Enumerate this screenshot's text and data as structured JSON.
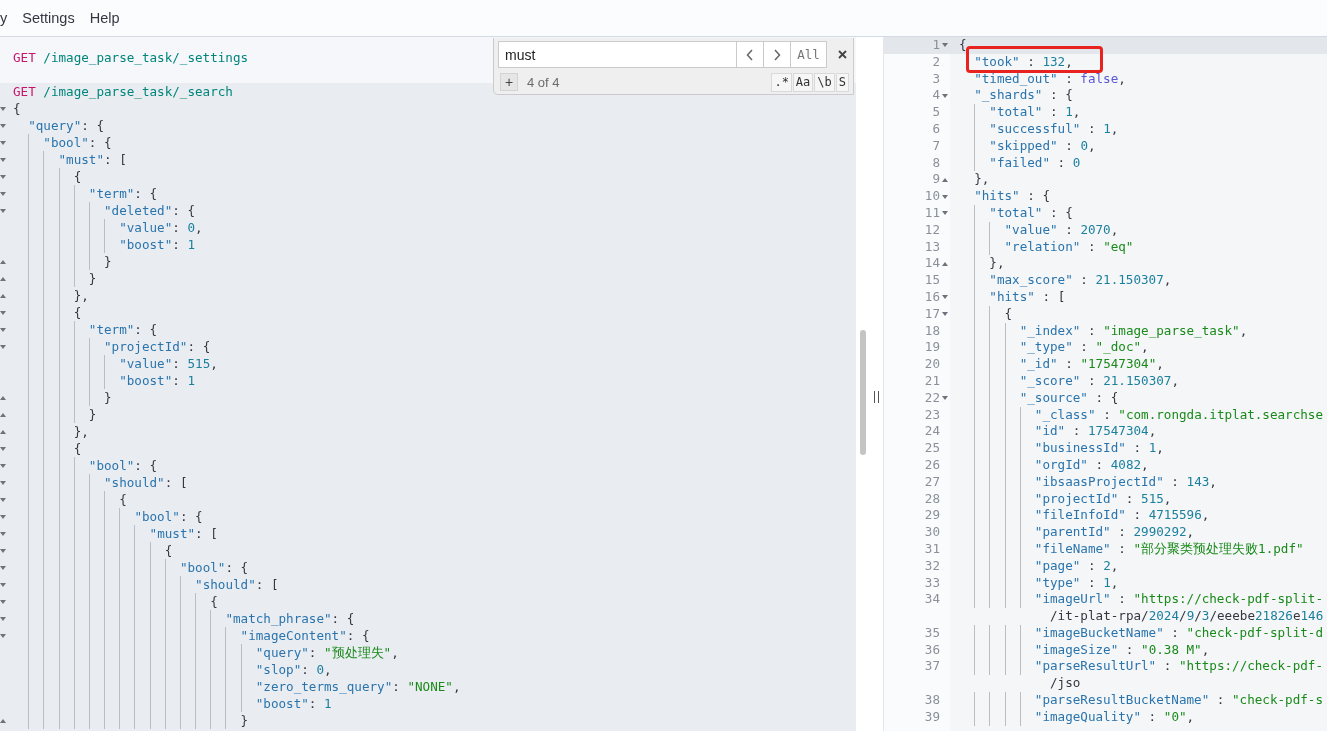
{
  "menu": [
    "y",
    "Settings",
    "Help"
  ],
  "console": {
    "requests": [
      {
        "method": "GET",
        "path": "/image_parse_task/_settings",
        "selected": false
      },
      {
        "method": "GET",
        "path": "/image_parse_task/_search",
        "selected": true,
        "lines": [
          {
            "text": "{",
            "kind": "open"
          },
          {
            "text": "  \"query\": {",
            "kind": "open"
          },
          {
            "text": "    \"bool\": {",
            "kind": "open"
          },
          {
            "text": "      \"must\": [",
            "kind": "open"
          },
          {
            "text": "        {",
            "kind": "open"
          },
          {
            "text": "          \"term\": {",
            "kind": "open"
          },
          {
            "text": "            \"deleted\": {",
            "kind": "open"
          },
          {
            "text": "              \"value\": 0,",
            "kind": "plain"
          },
          {
            "text": "              \"boost\": 1",
            "kind": "plain"
          },
          {
            "text": "            }",
            "kind": "close"
          },
          {
            "text": "          }",
            "kind": "close"
          },
          {
            "text": "        },",
            "kind": "close"
          },
          {
            "text": "        {",
            "kind": "open"
          },
          {
            "text": "          \"term\": {",
            "kind": "open"
          },
          {
            "text": "            \"projectId\": {",
            "kind": "open"
          },
          {
            "text": "              \"value\": 515,",
            "kind": "plain"
          },
          {
            "text": "              \"boost\": 1",
            "kind": "plain"
          },
          {
            "text": "            }",
            "kind": "close"
          },
          {
            "text": "          }",
            "kind": "close"
          },
          {
            "text": "        },",
            "kind": "close"
          },
          {
            "text": "        {",
            "kind": "open"
          },
          {
            "text": "          \"bool\": {",
            "kind": "open"
          },
          {
            "text": "            \"should\": [",
            "kind": "open"
          },
          {
            "text": "              {",
            "kind": "open"
          },
          {
            "text": "                \"bool\": {",
            "kind": "open"
          },
          {
            "text": "                  \"must\": [",
            "kind": "open"
          },
          {
            "text": "                    {",
            "kind": "open"
          },
          {
            "text": "                      \"bool\": {",
            "kind": "open"
          },
          {
            "text": "                        \"should\": [",
            "kind": "open"
          },
          {
            "text": "                          {",
            "kind": "open"
          },
          {
            "text": "                            \"match_phrase\": {",
            "kind": "open"
          },
          {
            "text": "                              \"imageContent\": {",
            "kind": "open"
          },
          {
            "text": "                                \"query\": \"预处理失\",",
            "kind": "plain"
          },
          {
            "text": "                                \"slop\": 0,",
            "kind": "plain"
          },
          {
            "text": "                                \"zero_terms_query\": \"NONE\",",
            "kind": "plain"
          },
          {
            "text": "                                \"boost\": 1",
            "kind": "plain"
          },
          {
            "text": "                              }",
            "kind": "close"
          }
        ]
      }
    ]
  },
  "search": {
    "value": "must",
    "all_label": "All",
    "replace_toggle": "+",
    "result": "4 of 4",
    "options": [
      ".*",
      "Aa",
      "\\b",
      "S"
    ]
  },
  "response": {
    "annotation": {
      "color": "#e8231f"
    },
    "lines": [
      {
        "n": "1",
        "text": "{",
        "kind": "open",
        "current": true
      },
      {
        "n": "2",
        "text": "  \"took\" : 132,",
        "kind": "plain",
        "current": false
      },
      {
        "n": "3",
        "text": "  \"timed_out\" : false,",
        "kind": "plain",
        "current": false
      },
      {
        "n": "4",
        "text": "  \"_shards\" : {",
        "kind": "open",
        "current": false
      },
      {
        "n": "5",
        "text": "    \"total\" : 1,",
        "kind": "plain",
        "current": false
      },
      {
        "n": "6",
        "text": "    \"successful\" : 1,",
        "kind": "plain",
        "current": false
      },
      {
        "n": "7",
        "text": "    \"skipped\" : 0,",
        "kind": "plain",
        "current": false
      },
      {
        "n": "8",
        "text": "    \"failed\" : 0",
        "kind": "plain",
        "current": false
      },
      {
        "n": "9",
        "text": "  },",
        "kind": "close",
        "current": false
      },
      {
        "n": "10",
        "text": "  \"hits\" : {",
        "kind": "open",
        "current": false
      },
      {
        "n": "11",
        "text": "    \"total\" : {",
        "kind": "open",
        "current": false
      },
      {
        "n": "12",
        "text": "      \"value\" : 2070,",
        "kind": "plain",
        "current": false
      },
      {
        "n": "13",
        "text": "      \"relation\" : \"eq\"",
        "kind": "plain",
        "current": false
      },
      {
        "n": "14",
        "text": "    },",
        "kind": "close",
        "current": false
      },
      {
        "n": "15",
        "text": "    \"max_score\" : 21.150307,",
        "kind": "plain",
        "current": false
      },
      {
        "n": "16",
        "text": "    \"hits\" : [",
        "kind": "open",
        "current": false
      },
      {
        "n": "17",
        "text": "      {",
        "kind": "open",
        "current": false
      },
      {
        "n": "18",
        "text": "        \"_index\" : \"image_parse_task\",",
        "kind": "plain",
        "current": false
      },
      {
        "n": "19",
        "text": "        \"_type\" : \"_doc\",",
        "kind": "plain",
        "current": false
      },
      {
        "n": "20",
        "text": "        \"_id\" : \"17547304\",",
        "kind": "plain",
        "current": false
      },
      {
        "n": "21",
        "text": "        \"_score\" : 21.150307,",
        "kind": "plain",
        "current": false
      },
      {
        "n": "22",
        "text": "        \"_source\" : {",
        "kind": "open",
        "current": false
      },
      {
        "n": "23",
        "text": "          \"_class\" : \"com.rongda.itplat.searchse",
        "kind": "plain",
        "current": false
      },
      {
        "n": "24",
        "text": "          \"id\" : 17547304,",
        "kind": "plain",
        "current": false
      },
      {
        "n": "25",
        "text": "          \"businessId\" : 1,",
        "kind": "plain",
        "current": false
      },
      {
        "n": "26",
        "text": "          \"orgId\" : 4082,",
        "kind": "plain",
        "current": false
      },
      {
        "n": "27",
        "text": "          \"ibsaasProjectId\" : 143,",
        "kind": "plain",
        "current": false
      },
      {
        "n": "28",
        "text": "          \"projectId\" : 515,",
        "kind": "plain",
        "current": false
      },
      {
        "n": "29",
        "text": "          \"fileInfoId\" : 4715596,",
        "kind": "plain",
        "current": false
      },
      {
        "n": "30",
        "text": "          \"parentId\" : 2990292,",
        "kind": "plain",
        "current": false
      },
      {
        "n": "31",
        "text": "          \"fileName\" : \"部分聚类预处理失败1.pdf\"",
        "kind": "plain",
        "current": false
      },
      {
        "n": "32",
        "text": "          \"page\" : 2,",
        "kind": "plain",
        "current": false
      },
      {
        "n": "33",
        "text": "          \"type\" : 1,",
        "kind": "plain",
        "current": false
      },
      {
        "n": "34",
        "text": "          \"imageUrl\" : \"https://check-pdf-split-",
        "wrap": "/it-plat-rpa/2024/9/3/eeebe21826e146",
        "kind": "plain",
        "current": false
      },
      {
        "n": "35",
        "text": "          \"imageBucketName\" : \"check-pdf-split-d",
        "kind": "plain",
        "current": false
      },
      {
        "n": "36",
        "text": "          \"imageSize\" : \"0.38 M\",",
        "kind": "plain",
        "current": false
      },
      {
        "n": "37",
        "text": "          \"parseResultUrl\" : \"https://check-pdf-",
        "wrap": "/jso",
        "kind": "plain",
        "current": false
      },
      {
        "n": "38",
        "text": "          \"parseResultBucketName\" : \"check-pdf-s",
        "kind": "plain",
        "current": false
      },
      {
        "n": "39",
        "text": "          \"imageQuality\" : \"0\",",
        "kind": "plain",
        "current": false
      }
    ]
  }
}
